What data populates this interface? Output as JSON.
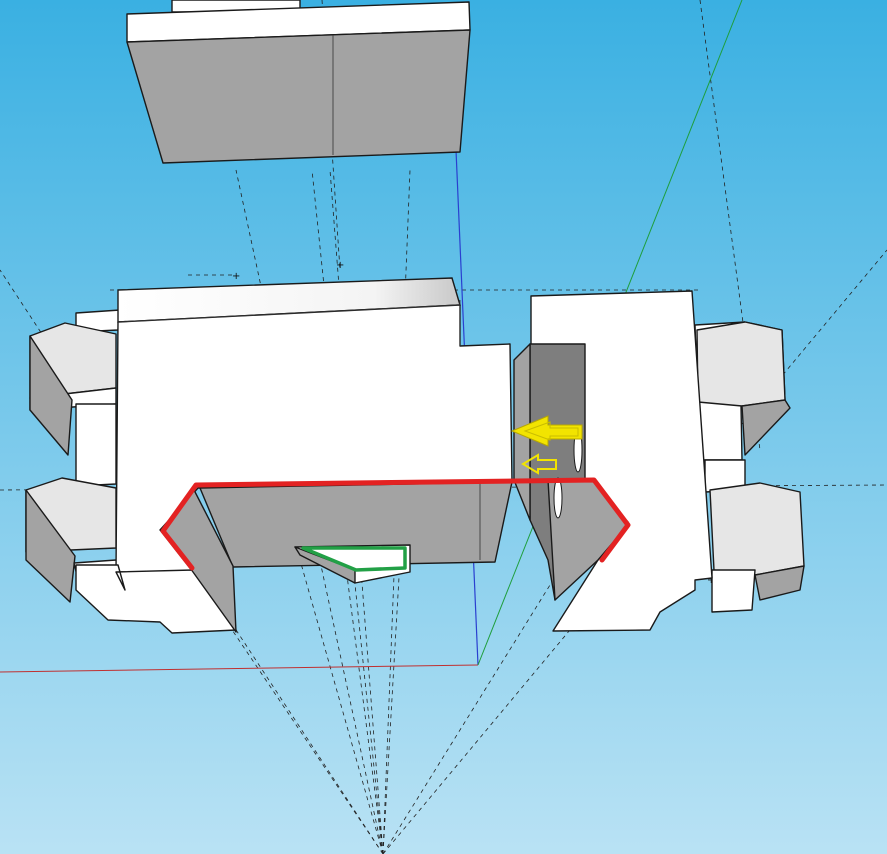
{
  "scene": {
    "background_top": "#3ab0e2",
    "background_bottom": "#b9e2f4",
    "axis_colors": {
      "red": "#c03030",
      "green": "#1e9e3c",
      "blue": "#2a3fd0"
    },
    "part_colors": {
      "top_face": "#ffffff",
      "light_face": "#e6e6e6",
      "side_face": "#a3a3a3",
      "dark_face": "#7e7e7e"
    },
    "annotation_colors": {
      "outline": "#e32222",
      "large_arrow": "#f2e400",
      "small_arrow": "#f2e400",
      "highlight": "#22a046"
    }
  }
}
